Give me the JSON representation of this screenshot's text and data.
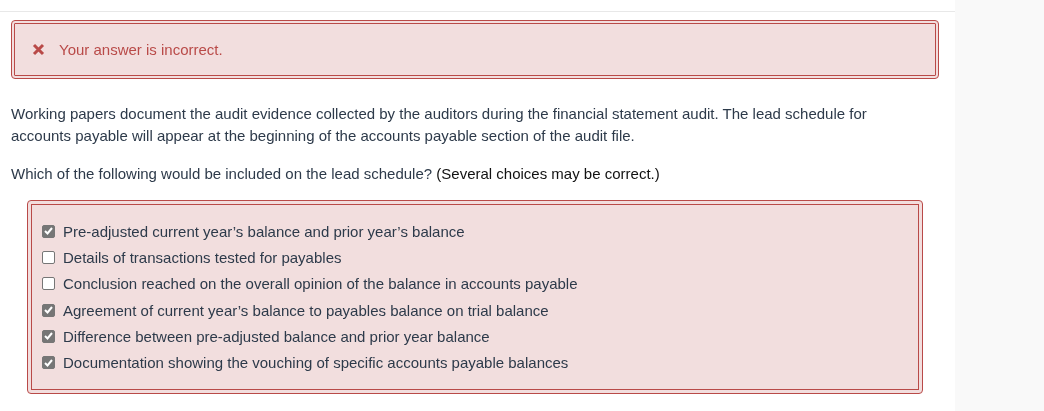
{
  "feedback": {
    "kind": "incorrect",
    "message": "Your answer is incorrect."
  },
  "intro": "Working papers document the audit evidence collected by the auditors during the financial statement audit. The lead schedule for accounts payable will appear at the beginning of the accounts payable section of the audit file.",
  "question": {
    "text": "Which of the following would be included on the lead schedule?",
    "hint": "(Several choices may be correct.)"
  },
  "choices": [
    {
      "label": "Pre-adjusted current year’s balance and prior year’s balance",
      "checked": true
    },
    {
      "label": "Details of transactions tested for payables",
      "checked": false
    },
    {
      "label": "Conclusion reached on the overall opinion of the balance in accounts payable",
      "checked": false
    },
    {
      "label": "Agreement of current year’s balance to payables balance on trial balance",
      "checked": true
    },
    {
      "label": "Difference between pre-adjusted balance and prior year balance",
      "checked": true
    },
    {
      "label": "Documentation showing the vouching of specific accounts payable balances",
      "checked": true
    }
  ]
}
